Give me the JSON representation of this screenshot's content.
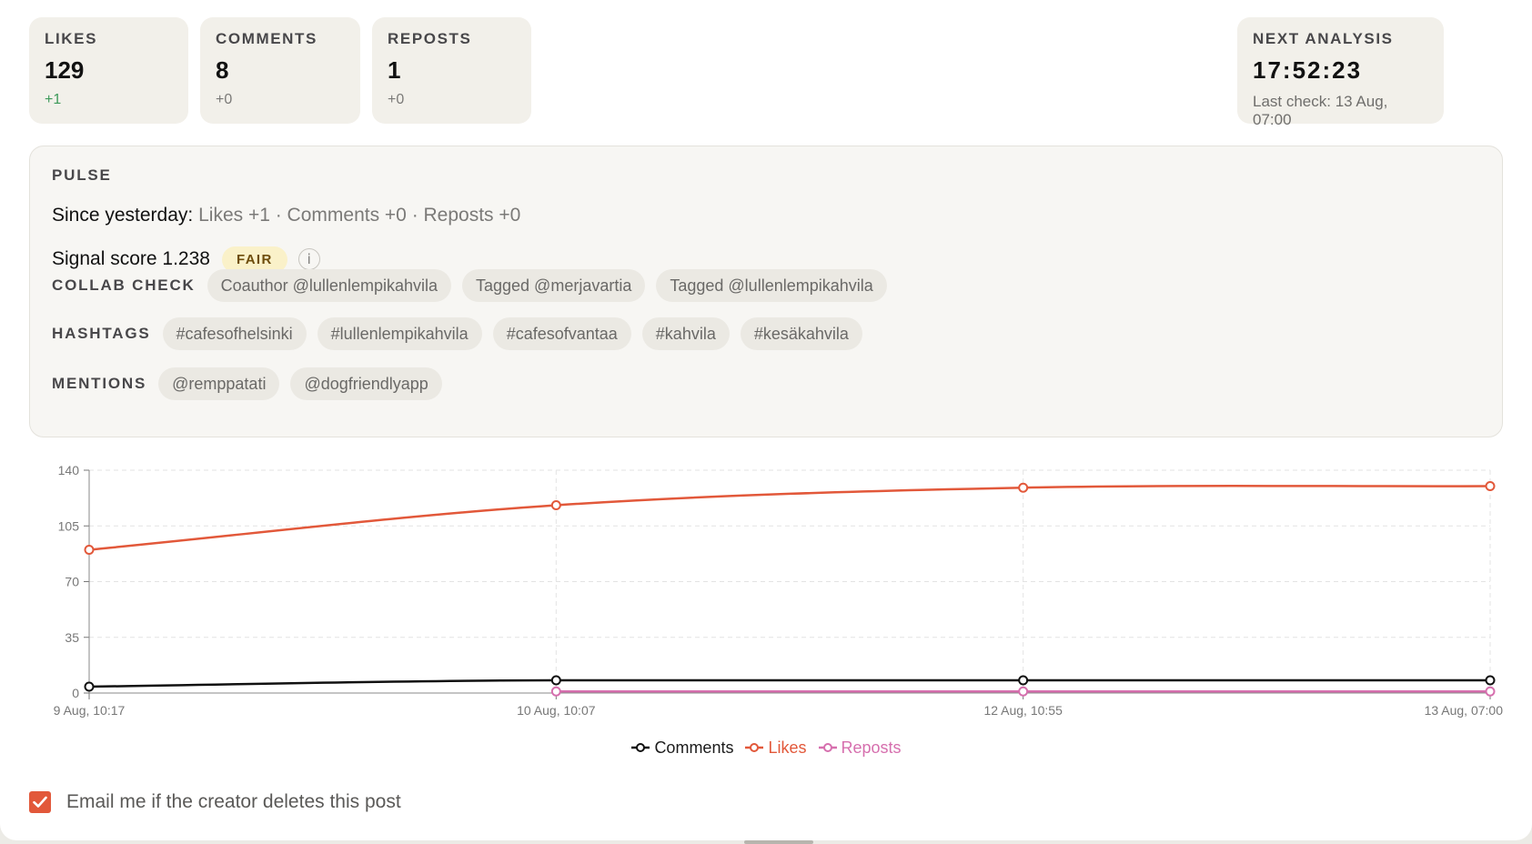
{
  "stats": [
    {
      "label": "LIKES",
      "value": "129",
      "delta": "+1",
      "delta_positive": true
    },
    {
      "label": "COMMENTS",
      "value": "8",
      "delta": "+0",
      "delta_positive": false
    },
    {
      "label": "REPOSTS",
      "value": "1",
      "delta": "+0",
      "delta_positive": false
    }
  ],
  "next_analysis": {
    "label": "NEXT ANALYSIS",
    "countdown": "17:52:23",
    "last_check": "Last check: 13 Aug, 07:00"
  },
  "pulse": {
    "title": "PULSE",
    "since_label": "Since yesterday:",
    "since_text": "Likes +1 · Comments +0 · Reposts +0",
    "signal_label": "Signal score 1.238",
    "signal_badge": "FAIR",
    "info_glyph": "i",
    "collab": {
      "label": "COLLAB CHECK",
      "chips": [
        "Coauthor @lullenlempikahvila",
        "Tagged @merjavartia",
        "Tagged @lullenlempikahvila"
      ]
    },
    "hashtags": {
      "label": "HASHTAGS",
      "chips": [
        "#cafesofhelsinki",
        "#lullenlempikahvila",
        "#cafesofvantaa",
        "#kahvila",
        "#kesäkahvila"
      ]
    },
    "mentions": {
      "label": "MENTIONS",
      "chips": [
        "@remppatati",
        "@dogfriendlyapp"
      ]
    }
  },
  "chart_data": {
    "type": "line",
    "x": [
      "9 Aug, 10:17",
      "10 Aug, 10:07",
      "12 Aug, 10:55",
      "13 Aug, 07:00"
    ],
    "ylim": [
      0,
      140
    ],
    "yticks": [
      0,
      35,
      70,
      105,
      140
    ],
    "grid": true,
    "legend_position": "bottom",
    "series": [
      {
        "name": "Comments",
        "color": "#111111",
        "values": [
          4,
          8,
          8,
          8
        ]
      },
      {
        "name": "Likes",
        "color": "#e2583a",
        "values": [
          90,
          118,
          129,
          130
        ]
      },
      {
        "name": "Reposts",
        "color": "#d66fae",
        "values": [
          null,
          1,
          1,
          1
        ]
      }
    ]
  },
  "email_option": {
    "label": "Email me if the creator deletes this post",
    "checked": true
  },
  "colors": {
    "accent": "#e2583a",
    "positive": "#3e9a5a",
    "badge_bg": "#faf1c9"
  }
}
